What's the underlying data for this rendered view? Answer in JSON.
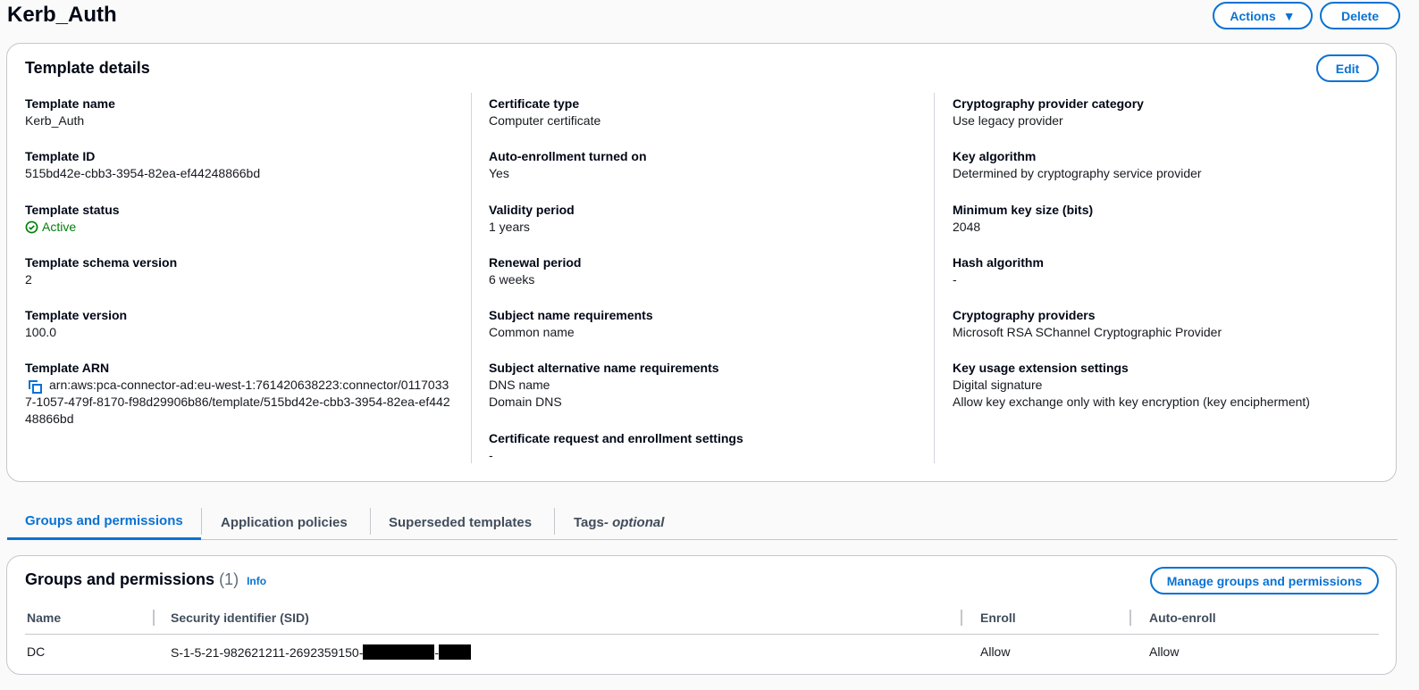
{
  "page": {
    "title": "Kerb_Auth",
    "actions_label": "Actions",
    "delete_label": "Delete"
  },
  "details": {
    "title": "Template details",
    "edit_label": "Edit",
    "col1": [
      {
        "label": "Template name",
        "value": "Kerb_Auth"
      },
      {
        "label": "Template ID",
        "value": "515bd42e-cbb3-3954-82ea-ef44248866bd"
      },
      {
        "label": "Template status",
        "value": "Active"
      },
      {
        "label": "Template schema version",
        "value": "2"
      },
      {
        "label": "Template version",
        "value": "100.0"
      },
      {
        "label": "Template ARN",
        "value": "arn:aws:pca-connector-ad:eu-west-1:761420638223:connector/01170337-1057-479f-8170-f98d29906b86/template/515bd42e-cbb3-3954-82ea-ef44248866bd"
      }
    ],
    "col2": [
      {
        "label": "Certificate type",
        "value": "Computer certificate"
      },
      {
        "label": "Auto-enrollment turned on",
        "value": "Yes"
      },
      {
        "label": "Validity period",
        "value": "1 years"
      },
      {
        "label": "Renewal period",
        "value": "6 weeks"
      },
      {
        "label": "Subject name requirements",
        "value": "Common name"
      },
      {
        "label": "Subject alternative name requirements",
        "values": [
          "DNS name",
          "Domain DNS"
        ]
      },
      {
        "label": "Certificate request and enrollment settings",
        "value": "-"
      }
    ],
    "col3": [
      {
        "label": "Cryptography provider category",
        "value": "Use legacy provider"
      },
      {
        "label": "Key algorithm",
        "value": "Determined by cryptography service provider"
      },
      {
        "label": "Minimum key size (bits)",
        "value": "2048"
      },
      {
        "label": "Hash algorithm",
        "value": "-"
      },
      {
        "label": "Cryptography providers",
        "value": "Microsoft RSA SChannel Cryptographic Provider"
      },
      {
        "label": "Key usage extension settings",
        "values": [
          "Digital signature",
          "Allow key exchange only with key encryption (key encipherment)"
        ]
      }
    ]
  },
  "tabs": [
    {
      "label": "Groups and permissions"
    },
    {
      "label": "Application policies"
    },
    {
      "label": "Superseded templates"
    },
    {
      "label": "Tags",
      "suffix": " - optional"
    }
  ],
  "groups": {
    "title": "Groups and permissions",
    "count": "(1)",
    "info": "Info",
    "manage_label": "Manage groups and permissions",
    "columns": [
      "Name",
      "Security identifier (SID)",
      "Enroll",
      "Auto-enroll"
    ],
    "rows": [
      {
        "name": "DC",
        "sid": "S-1-5-21-982621211-2692359150-",
        "sid_sep": "-",
        "enroll": "Allow",
        "auto_enroll": "Allow"
      }
    ]
  },
  "colors": {
    "accent": "#0972d3",
    "success": "#037f0c"
  }
}
